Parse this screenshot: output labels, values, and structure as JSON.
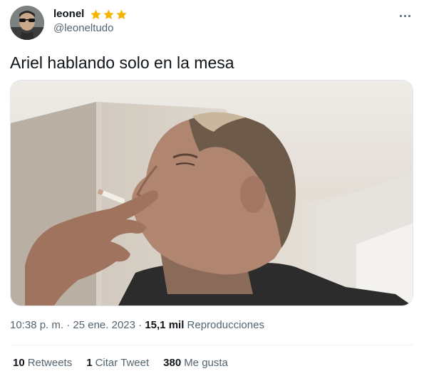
{
  "author": {
    "display_name": "leonel",
    "handle": "@leoneltudo",
    "badges": [
      "star-icon",
      "star-icon",
      "star-icon"
    ],
    "badge_color": "#f4b400"
  },
  "tweet": {
    "text": "Ariel hablando solo en la mesa"
  },
  "meta": {
    "time": "10:38 p. m.",
    "separator1": " · ",
    "date": "25 ene. 2023",
    "separator2": " · ",
    "views_count": "15,1 mil",
    "views_label": "Reproducciones"
  },
  "stats": {
    "retweets_count": "10",
    "retweets_label": "Retweets",
    "quotes_count": "1",
    "quotes_label": "Citar Tweet",
    "likes_count": "380",
    "likes_label": "Me gusta"
  },
  "icons": {
    "more": "more-icon"
  }
}
